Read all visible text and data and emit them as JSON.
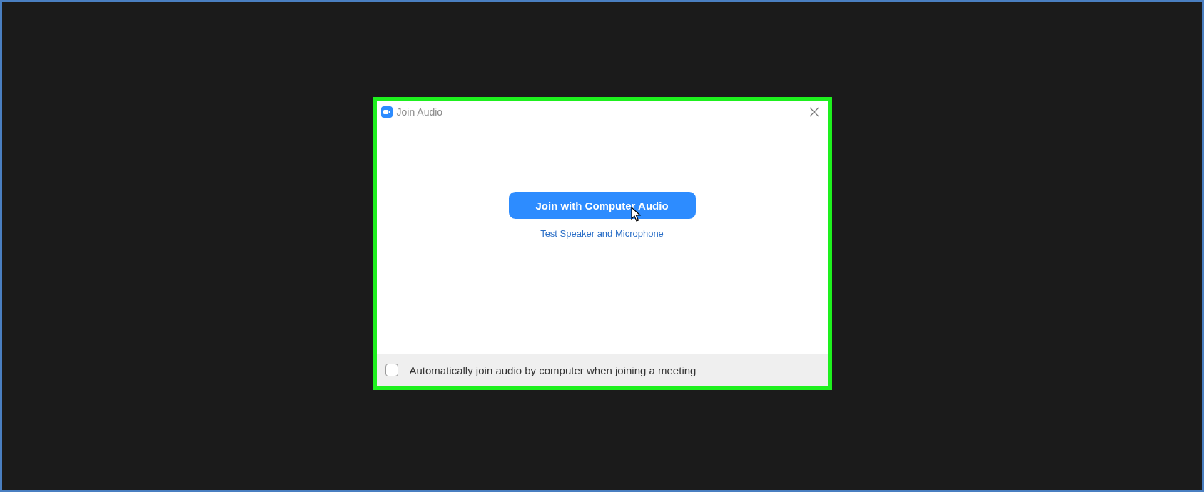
{
  "window": {
    "title": "Join Audio"
  },
  "join_button": {
    "label": "Join with Computer Audio"
  },
  "test_link": {
    "label": "Test Speaker and Microphone"
  },
  "auto_join": {
    "label": "Automatically join audio by computer when joining a meeting",
    "checked": false
  }
}
